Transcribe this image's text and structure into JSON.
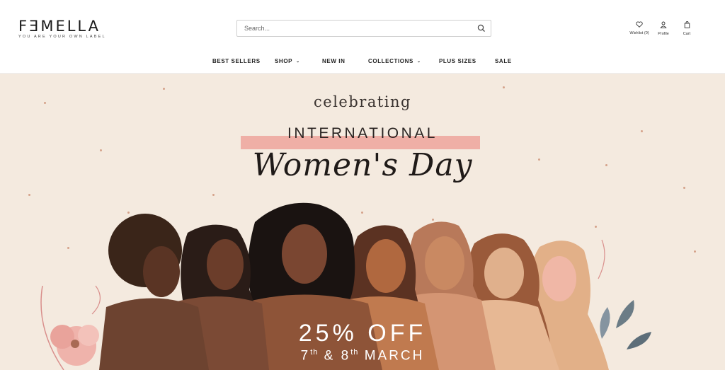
{
  "brand": {
    "name": "FƎMELLA",
    "tagline": "YOU ARE YOUR OWN LABEL"
  },
  "search": {
    "placeholder": "Search..."
  },
  "user_links": {
    "wishlist_label": "Wishlist (0)",
    "profile_label": "Profile",
    "cart_label": "Cart"
  },
  "nav": {
    "items": [
      {
        "label": "BEST SELLERS",
        "has_dropdown": false
      },
      {
        "label": "SHOP",
        "has_dropdown": true
      },
      {
        "label": "NEW IN",
        "has_dropdown": false
      },
      {
        "label": "COLLECTIONS",
        "has_dropdown": true
      },
      {
        "label": "PLUS SIZES",
        "has_dropdown": false
      },
      {
        "label": "SALE",
        "has_dropdown": false
      }
    ],
    "dropdown_glyph": "⌄"
  },
  "hero": {
    "line1": "celebrating",
    "line2": "INTERNATIONAL",
    "line3": "Women's Day",
    "offer": "25% OFF",
    "date1": "7",
    "date1_suffix": "th",
    "date_joiner": " & ",
    "date2": "8",
    "date2_suffix": "th",
    "month": "MARCH"
  },
  "colors": {
    "hero_background": "#f4eadf",
    "highlight_band": "#eea8a0",
    "text_dark": "#222222",
    "offer_text": "#ffffff"
  },
  "icons": {
    "search": "search-icon",
    "wishlist": "heart-icon",
    "profile": "user-icon",
    "cart": "shopping-bag-icon"
  }
}
